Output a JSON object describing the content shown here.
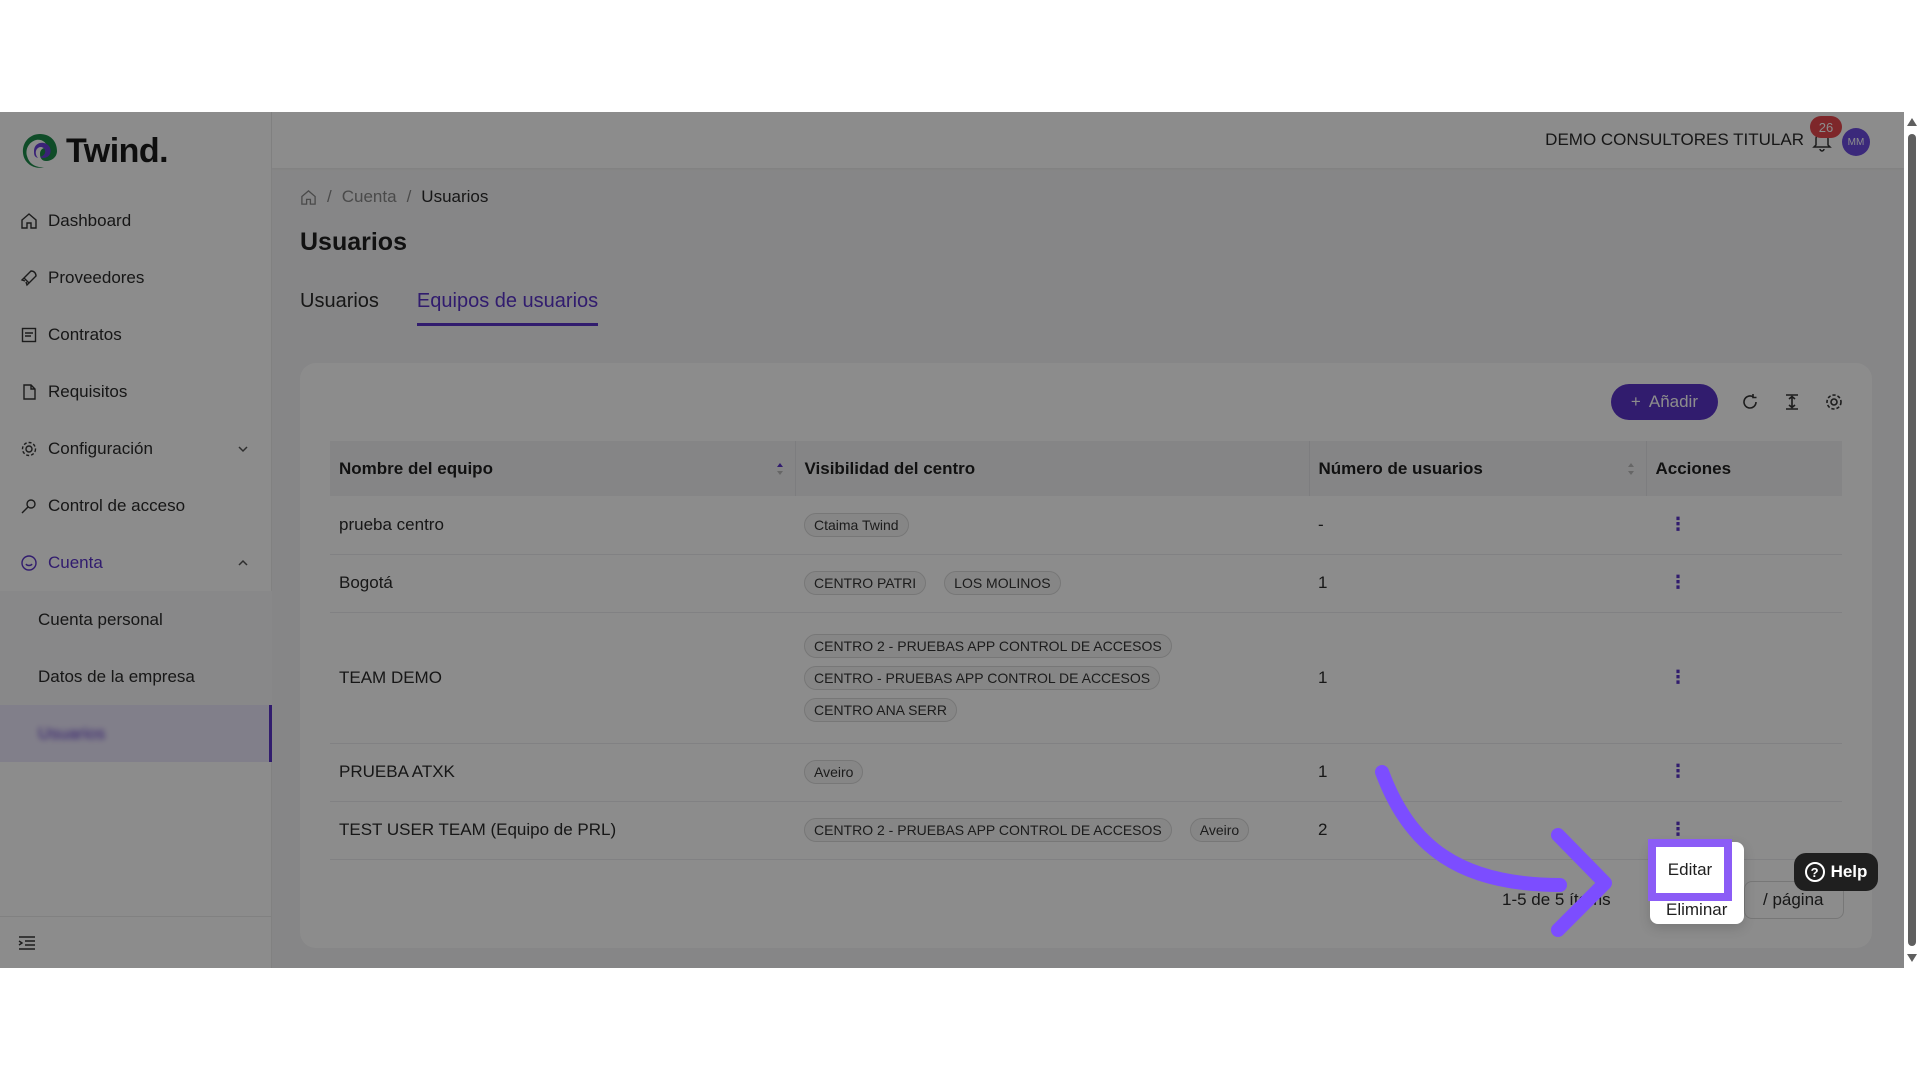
{
  "brand": {
    "name": "Twind."
  },
  "sidebar": {
    "items": [
      {
        "label": "Dashboard",
        "icon": "home-icon"
      },
      {
        "label": "Proveedores",
        "icon": "rocket-icon"
      },
      {
        "label": "Contratos",
        "icon": "contract-icon"
      },
      {
        "label": "Requisitos",
        "icon": "file-icon"
      },
      {
        "label": "Configuración",
        "icon": "gear-icon"
      },
      {
        "label": "Control de acceso",
        "icon": "key-icon"
      },
      {
        "label": "Cuenta",
        "icon": "smile-icon"
      }
    ],
    "sub_items": [
      {
        "label": "Cuenta personal"
      },
      {
        "label": "Datos de la empresa"
      },
      {
        "label": "Usuarios"
      }
    ]
  },
  "header": {
    "company": "DEMO CONSULTORES TITULAR",
    "notifications": "26",
    "avatar_initials": "MM"
  },
  "breadcrumb": {
    "items": [
      "Cuenta",
      "Usuarios"
    ]
  },
  "page": {
    "title": "Usuarios"
  },
  "tabs": [
    {
      "label": "Usuarios"
    },
    {
      "label": "Equipos de usuarios"
    }
  ],
  "toolbar": {
    "add_label": "Añadir"
  },
  "table": {
    "headers": [
      "Nombre del equipo",
      "Visibilidad del centro",
      "Número de usuarios",
      "Acciones"
    ],
    "rows": [
      {
        "name": "prueba centro",
        "tags": [
          "Ctaima Twind"
        ],
        "users": "-"
      },
      {
        "name": "Bogotá",
        "tags": [
          "CENTRO PATRI",
          "LOS MOLINOS"
        ],
        "users": "1"
      },
      {
        "name": "TEAM DEMO",
        "tags": [
          "CENTRO 2 - PRUEBAS APP CONTROL DE ACCESOS",
          "CENTRO - PRUEBAS APP CONTROL DE ACCESOS",
          "CENTRO ANA SERR"
        ],
        "users": "1"
      },
      {
        "name": "PRUEBA ATXK",
        "tags": [
          "Aveiro"
        ],
        "users": "1"
      },
      {
        "name": "TEST USER TEAM (Equipo de PRL)",
        "tags": [
          "CENTRO 2 - PRUEBAS APP CONTROL DE ACCESOS",
          "Aveiro"
        ],
        "users": "2"
      }
    ]
  },
  "pagination": {
    "summary": "1-5 de 5 ítems",
    "per_page": "/ página"
  },
  "context_menu": {
    "edit": "Editar",
    "delete": "Eliminar"
  },
  "help": {
    "label": "Help"
  },
  "colors": {
    "accent": "#5a33c9",
    "highlight": "#8b5cf6",
    "badge": "#e5484d"
  }
}
